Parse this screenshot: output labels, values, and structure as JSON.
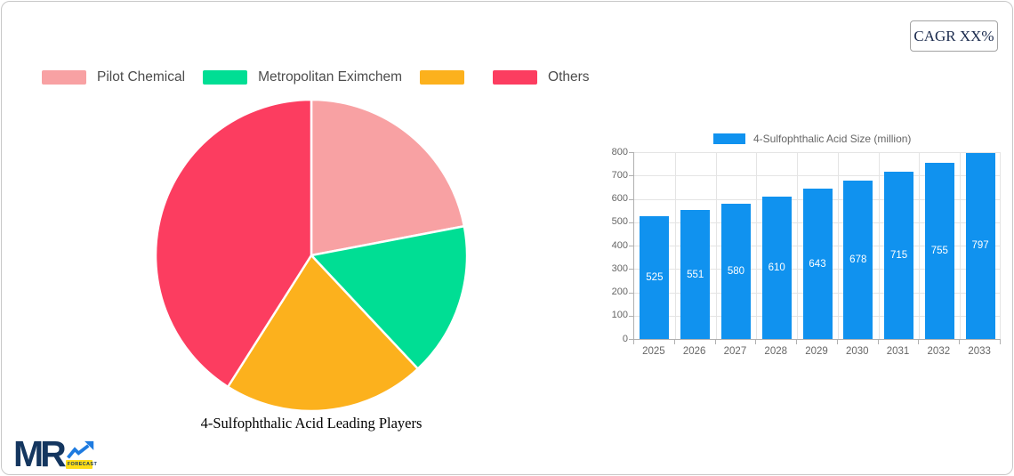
{
  "header": {
    "cagr_label": "CAGR XX%"
  },
  "logo": {
    "mr": "MR",
    "forecast": "FORECAST"
  },
  "pie": {
    "title": "4-Sulfophthalic Acid Leading Players",
    "legend": [
      {
        "label": "Pilot Chemical",
        "color": "#F8A1A3"
      },
      {
        "label": "Metropolitan Eximchem",
        "color": "#00DE94"
      },
      {
        "label": "",
        "color": "#FCB11D"
      },
      {
        "label": "Others",
        "color": "#FC3D60"
      }
    ]
  },
  "chart_data": [
    {
      "type": "pie",
      "title": "4-Sulfophthalic Acid Leading Players",
      "labels": [
        "Pilot Chemical",
        "Metropolitan Eximchem",
        "",
        "Others"
      ],
      "values": [
        22,
        16,
        21,
        41
      ],
      "colors": [
        "#F8A1A3",
        "#00DE94",
        "#FCB11D",
        "#FC3D60"
      ],
      "start_angle_deg": 0,
      "direction": "clockwise",
      "legend_position": "top-left"
    },
    {
      "type": "bar",
      "categories": [
        "2025",
        "2026",
        "2027",
        "2028",
        "2029",
        "2030",
        "2031",
        "2032",
        "2033"
      ],
      "series": [
        {
          "name": "4-Sulfophthalic Acid Size (million)",
          "values": [
            525,
            551,
            580,
            610,
            643,
            678,
            715,
            755,
            797
          ]
        }
      ],
      "ylim": [
        0,
        800
      ],
      "yticks": [
        0,
        100,
        200,
        300,
        400,
        500,
        600,
        700,
        800
      ],
      "bar_color": "#1092EF",
      "value_label_color": "#FFFFFF",
      "grid": true,
      "legend_position": "top"
    }
  ],
  "colors": {
    "bar_blue": "#1092EF",
    "logo_navy": "#14365F",
    "logo_arrow_blue": "#1E7BE0",
    "logo_yellow": "#FFDE17",
    "axis_text": "#666666",
    "legend_text": "#4d4d4d",
    "cagr_text": "#1b2b4e",
    "card_border": "#c8c8c8"
  }
}
